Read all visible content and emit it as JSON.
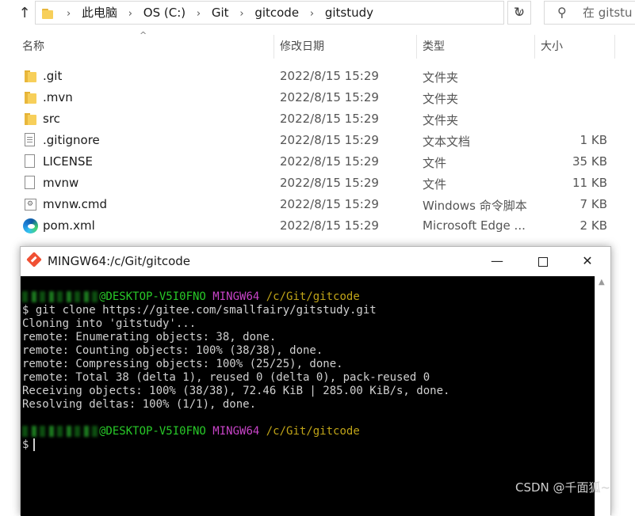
{
  "explorer": {
    "breadcrumb": [
      "此电脑",
      "OS (C:)",
      "Git",
      "gitcode",
      "gitstudy"
    ],
    "search_placeholder": "在 gitstu",
    "columns": {
      "name": "名称",
      "date": "修改日期",
      "type": "类型",
      "size": "大小"
    },
    "files": [
      {
        "icon": "folder-icon",
        "name": ".git",
        "date": "2022/8/15 15:29",
        "type": "文件夹",
        "size": ""
      },
      {
        "icon": "folder-icon",
        "name": ".mvn",
        "date": "2022/8/15 15:29",
        "type": "文件夹",
        "size": ""
      },
      {
        "icon": "folder-icon",
        "name": "src",
        "date": "2022/8/15 15:29",
        "type": "文件夹",
        "size": ""
      },
      {
        "icon": "text-file-icon",
        "name": ".gitignore",
        "date": "2022/8/15 15:29",
        "type": "文本文档",
        "size": "1 KB"
      },
      {
        "icon": "file-icon",
        "name": "LICENSE",
        "date": "2022/8/15 15:29",
        "type": "文件",
        "size": "35 KB"
      },
      {
        "icon": "file-icon",
        "name": "mvnw",
        "date": "2022/8/15 15:29",
        "type": "文件",
        "size": "11 KB"
      },
      {
        "icon": "cmd-file-icon",
        "name": "mvnw.cmd",
        "date": "2022/8/15 15:29",
        "type": "Windows 命令脚本",
        "size": "7 KB"
      },
      {
        "icon": "edge-icon",
        "name": "pom.xml",
        "date": "2022/8/15 15:29",
        "type": "Microsoft Edge ...",
        "size": "2 KB"
      }
    ]
  },
  "terminal": {
    "title": "MINGW64:/c/Git/gitcode",
    "prompt_host": "@DESKTOP-V5I0FNO",
    "prompt_env": "MINGW64",
    "prompt_path": "/c/Git/gitcode",
    "lines": [
      "$ git clone https://gitee.com/smallfairy/gitstudy.git",
      "Cloning into 'gitstudy'...",
      "remote: Enumerating objects: 38, done.",
      "remote: Counting objects: 100% (38/38), done.",
      "remote: Compressing objects: 100% (25/25), done.",
      "remote: Total 38 (delta 1), reused 0 (delta 0), pack-reused 0",
      "Receiving objects: 100% (38/38), 72.46 KiB | 285.00 KiB/s, done.",
      "Resolving deltas: 100% (1/1), done."
    ],
    "final_prompt": "$"
  },
  "watermark": "CSDN @千面狐~"
}
